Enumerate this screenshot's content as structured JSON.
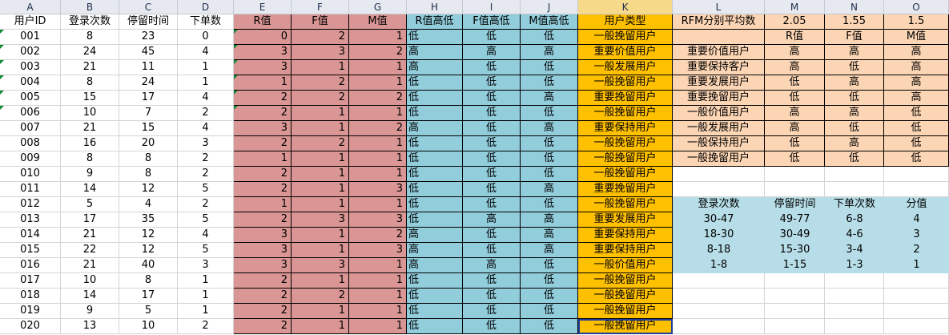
{
  "column_letters": [
    "A",
    "B",
    "C",
    "D",
    "E",
    "F",
    "G",
    "H",
    "I",
    "J",
    "K",
    "L",
    "M",
    "N",
    "O"
  ],
  "selected_column": "K",
  "active_cell": "K21",
  "fill_colors": {
    "rfm_scores": "#da9694",
    "high_low": "#92cddc",
    "user_type": "#ffc000",
    "summary_table": "#fcd5b4",
    "score_table": "#b7dee8",
    "triangle_marker": "#138a36"
  },
  "headers": [
    "用户ID",
    "登录次数",
    "停留时间",
    "下单数",
    "R值",
    "F值",
    "M值",
    "R值高低",
    "F值高低",
    "M值高低",
    "用户类型"
  ],
  "rows": [
    [
      "001",
      "8",
      "23",
      "0",
      "0",
      "2",
      "1",
      "低",
      "低",
      "低",
      "一般挽留用户"
    ],
    [
      "002",
      "24",
      "45",
      "4",
      "3",
      "3",
      "2",
      "高",
      "高",
      "高",
      "重要价值用户"
    ],
    [
      "003",
      "21",
      "11",
      "1",
      "3",
      "1",
      "1",
      "高",
      "低",
      "低",
      "一般发展用户"
    ],
    [
      "004",
      "8",
      "24",
      "1",
      "1",
      "2",
      "1",
      "低",
      "低",
      "低",
      "一般挽留用户"
    ],
    [
      "005",
      "15",
      "17",
      "4",
      "2",
      "2",
      "2",
      "低",
      "低",
      "高",
      "重要挽留用户"
    ],
    [
      "006",
      "10",
      "7",
      "2",
      "2",
      "1",
      "1",
      "低",
      "低",
      "低",
      "一般挽留用户"
    ],
    [
      "007",
      "21",
      "15",
      "4",
      "3",
      "1",
      "2",
      "高",
      "低",
      "高",
      "重要保持用户"
    ],
    [
      "008",
      "16",
      "20",
      "3",
      "2",
      "2",
      "1",
      "低",
      "低",
      "低",
      "一般挽留用户"
    ],
    [
      "009",
      "8",
      "8",
      "2",
      "1",
      "1",
      "1",
      "低",
      "低",
      "低",
      "一般挽留用户"
    ],
    [
      "010",
      "9",
      "8",
      "2",
      "2",
      "1",
      "1",
      "低",
      "低",
      "低",
      "一般挽留用户"
    ],
    [
      "011",
      "14",
      "12",
      "5",
      "2",
      "1",
      "3",
      "低",
      "低",
      "高",
      "重要挽留用户"
    ],
    [
      "012",
      "5",
      "4",
      "2",
      "1",
      "1",
      "1",
      "低",
      "低",
      "低",
      "一般挽留用户"
    ],
    [
      "013",
      "17",
      "35",
      "5",
      "2",
      "3",
      "3",
      "低",
      "高",
      "高",
      "重要发展用户"
    ],
    [
      "014",
      "21",
      "12",
      "4",
      "3",
      "1",
      "2",
      "高",
      "低",
      "高",
      "重要保持用户"
    ],
    [
      "015",
      "22",
      "12",
      "5",
      "3",
      "1",
      "3",
      "高",
      "低",
      "高",
      "重要保持用户"
    ],
    [
      "016",
      "21",
      "40",
      "3",
      "3",
      "3",
      "1",
      "高",
      "高",
      "低",
      "一般价值用户"
    ],
    [
      "017",
      "10",
      "8",
      "1",
      "2",
      "1",
      "1",
      "低",
      "低",
      "低",
      "一般挽留用户"
    ],
    [
      "018",
      "14",
      "17",
      "1",
      "2",
      "2",
      "1",
      "低",
      "低",
      "低",
      "一般挽留用户"
    ],
    [
      "019",
      "9",
      "5",
      "1",
      "2",
      "1",
      "1",
      "低",
      "低",
      "低",
      "一般挽留用户"
    ],
    [
      "020",
      "13",
      "10",
      "2",
      "2",
      "1",
      "1",
      "低",
      "低",
      "低",
      "一般挽留用户"
    ]
  ],
  "rfm_avg": {
    "label": "RFM分别平均数",
    "values": [
      "2.05",
      "1.55",
      "1.5"
    ]
  },
  "rfm_sub_headers": [
    "R值",
    "F值",
    "M值"
  ],
  "user_types": [
    {
      "name": "重要价值用户",
      "r": "高",
      "f": "高",
      "m": "高"
    },
    {
      "name": "重要保持客户",
      "r": "高",
      "f": "低",
      "m": "高"
    },
    {
      "name": "重要发展用户",
      "r": "低",
      "f": "高",
      "m": "高"
    },
    {
      "name": "重要挽留用户",
      "r": "低",
      "f": "低",
      "m": "高"
    },
    {
      "name": "一般价值用户",
      "r": "高",
      "f": "高",
      "m": "低"
    },
    {
      "name": "一般发展用户",
      "r": "高",
      "f": "低",
      "m": "低"
    },
    {
      "name": "一般保持用户",
      "r": "低",
      "f": "高",
      "m": "低"
    },
    {
      "name": "一般挽留用户",
      "r": "低",
      "f": "低",
      "m": "低"
    }
  ],
  "score_table": {
    "headers": [
      "登录次数",
      "停留时间",
      "下单次数",
      "分值"
    ],
    "rows": [
      [
        "30-47",
        "49-77",
        "6-8",
        "4"
      ],
      [
        "18-30",
        "30-49",
        "4-6",
        "3"
      ],
      [
        "8-18",
        "15-30",
        "3-4",
        "2"
      ],
      [
        "1-8",
        "1-15",
        "1-3",
        "1"
      ]
    ]
  }
}
